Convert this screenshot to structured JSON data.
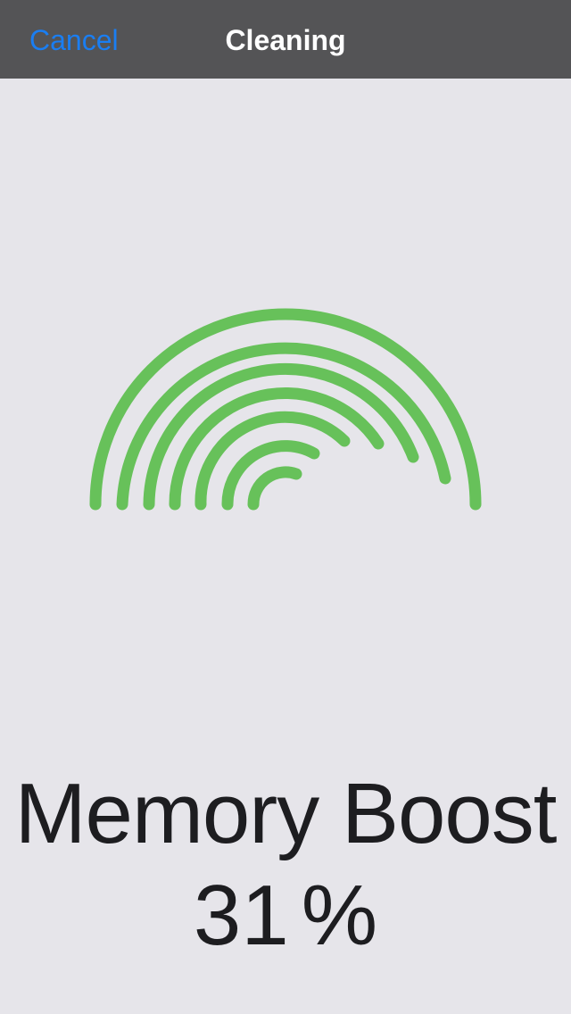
{
  "nav": {
    "cancel_label": "Cancel",
    "title": "Cleaning"
  },
  "main": {
    "headline": "Memory Boost",
    "progress_value": "31",
    "progress_unit": "%"
  },
  "colors": {
    "accent": "#1a7ef2",
    "arc": "#67c15a",
    "nav_background": "#545456",
    "page_background": "#e6e5ea"
  },
  "icons": {
    "cleaning_graphic": "concentric-arcs-icon"
  }
}
